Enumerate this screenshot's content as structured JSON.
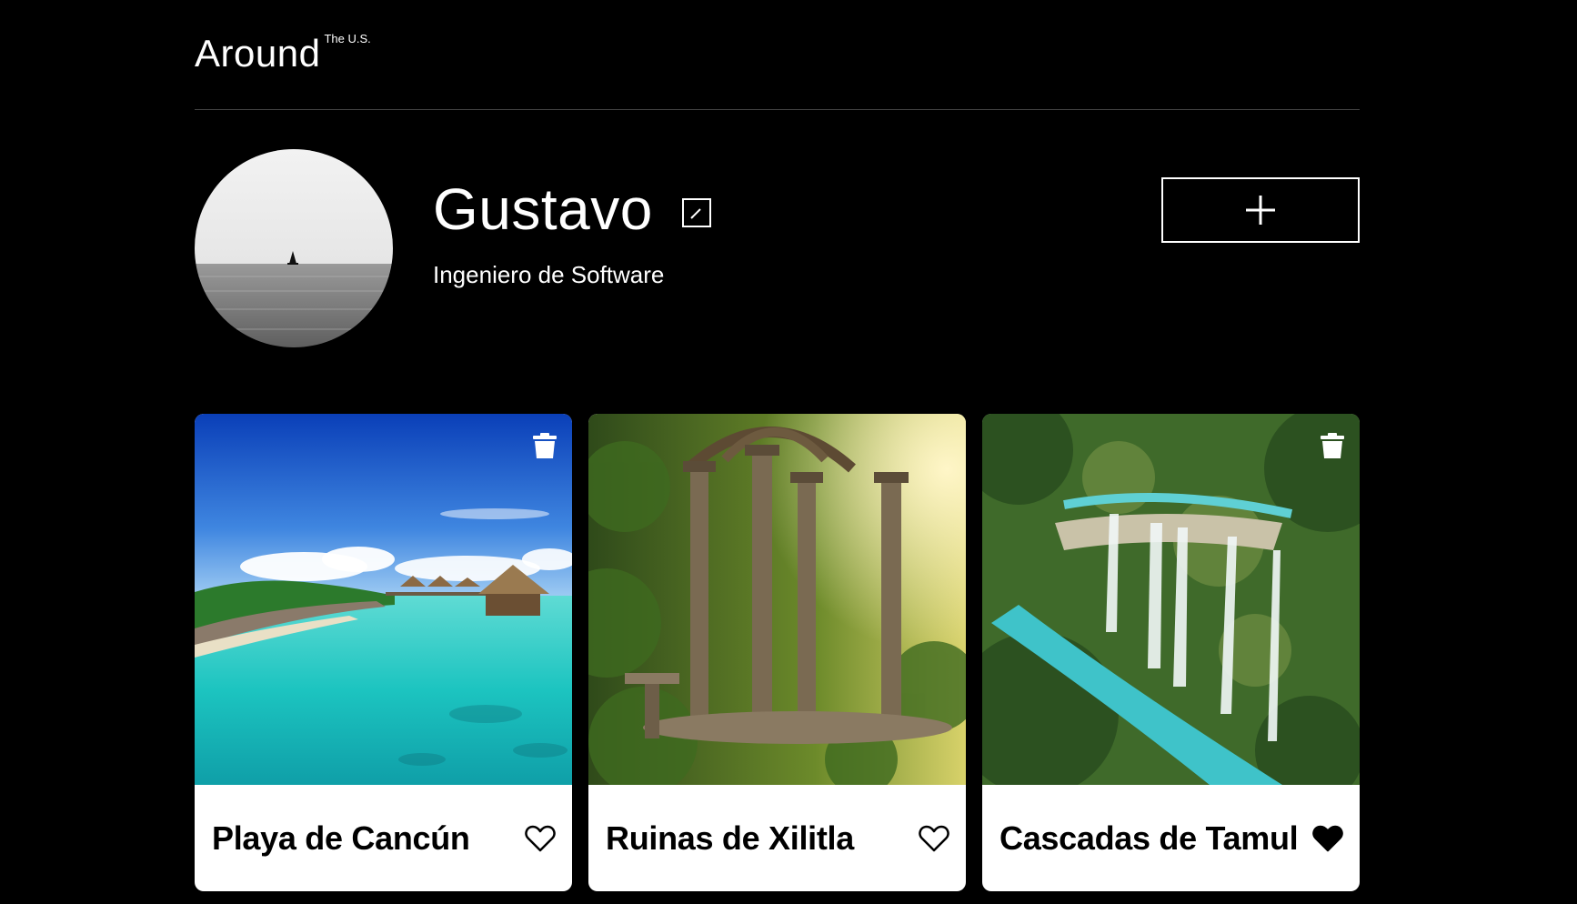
{
  "header": {
    "logo_main": "Around",
    "logo_sup": "The U.S."
  },
  "profile": {
    "name": "Gustavo",
    "job": "Ingeniero de Software",
    "edit_icon": "pencil-icon",
    "add_icon": "plus-icon"
  },
  "cards": [
    {
      "title": "Playa de Cancún",
      "liked": false,
      "show_delete": true
    },
    {
      "title": "Ruinas de Xilitla",
      "liked": false,
      "show_delete": false
    },
    {
      "title": "Cascadas de Tamul",
      "liked": true,
      "show_delete": true
    }
  ],
  "colors": {
    "background": "#000000",
    "card": "#ffffff",
    "text_dark": "#000000"
  }
}
